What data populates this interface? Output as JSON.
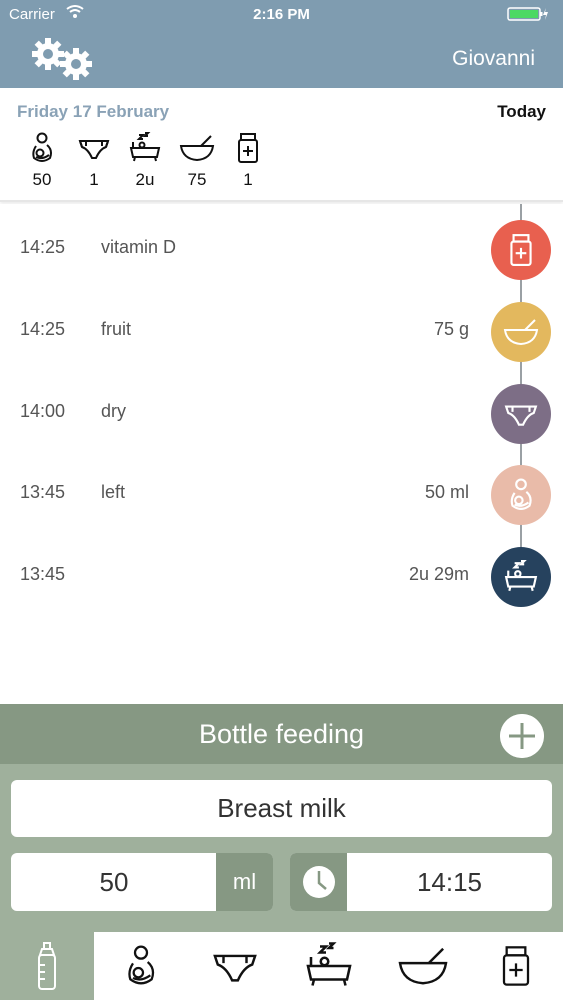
{
  "status_bar": {
    "carrier": "Carrier",
    "time": "2:16 PM"
  },
  "nav": {
    "settings_icon": "gears-icon",
    "user_name": "Giovanni"
  },
  "summary": {
    "date": "Friday 17 February",
    "today_label": "Today",
    "stats": [
      {
        "icon": "breastfeeding-icon",
        "value": "50"
      },
      {
        "icon": "diaper-icon",
        "value": "1"
      },
      {
        "icon": "sleep-icon",
        "value": "2u"
      },
      {
        "icon": "food-bowl-icon",
        "value": "75"
      },
      {
        "icon": "medicine-icon",
        "value": "1"
      }
    ]
  },
  "events": [
    {
      "time": "14:25",
      "name": "vitamin D",
      "amount": "",
      "icon": "medicine-icon",
      "color": "#e8604f"
    },
    {
      "time": "14:25",
      "name": "fruit",
      "amount": "75 g",
      "icon": "food-bowl-icon",
      "color": "#e3b85e"
    },
    {
      "time": "14:00",
      "name": "dry",
      "amount": "",
      "icon": "diaper-icon",
      "color": "#7d6e86"
    },
    {
      "time": "13:45",
      "name": "left",
      "amount": "50 ml",
      "icon": "breastfeeding-icon",
      "color": "#e9bba9"
    },
    {
      "time": "13:45",
      "name": "",
      "amount": "2u 29m",
      "icon": "sleep-icon",
      "color": "#26425e"
    }
  ],
  "entry": {
    "title": "Bottle feeding",
    "type_value": "Breast milk",
    "quantity_value": "50",
    "quantity_unit": "ml",
    "time_value": "14:15"
  },
  "tabs": [
    {
      "icon": "bottle-icon",
      "active": true
    },
    {
      "icon": "breastfeeding-icon",
      "active": false
    },
    {
      "icon": "diaper-icon",
      "active": false
    },
    {
      "icon": "sleep-icon",
      "active": false
    },
    {
      "icon": "food-bowl-icon",
      "active": false
    },
    {
      "icon": "medicine-icon",
      "active": false
    }
  ],
  "colors": {
    "header_blue": "#7f9cb0",
    "panel_green": "#9fb09c",
    "panel_dark_green": "#869883",
    "battery_green": "#4cd964"
  }
}
